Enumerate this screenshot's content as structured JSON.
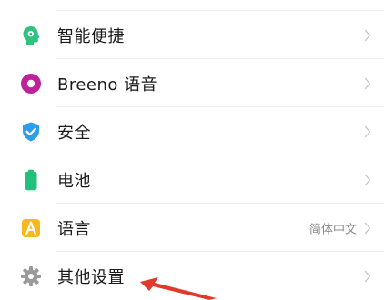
{
  "settings": {
    "items": [
      {
        "label": "智能便捷",
        "icon": "smart-assistant-icon",
        "value": ""
      },
      {
        "label": "Breeno 语音",
        "icon": "breeno-voice-icon",
        "value": ""
      },
      {
        "label": "安全",
        "icon": "security-shield-icon",
        "value": ""
      },
      {
        "label": "电池",
        "icon": "battery-icon",
        "value": ""
      },
      {
        "label": "语言",
        "icon": "language-icon",
        "value": "简体中文"
      },
      {
        "label": "其他设置",
        "icon": "gear-icon",
        "value": ""
      }
    ]
  },
  "colors": {
    "smart_assistant": "#2ec27e",
    "breeno": "#c0219a",
    "security": "#2f9ee8",
    "battery": "#22c07a",
    "language": "#f6b81c",
    "gear": "#9a9a9a",
    "annotation_arrow": "#e03a2f"
  }
}
